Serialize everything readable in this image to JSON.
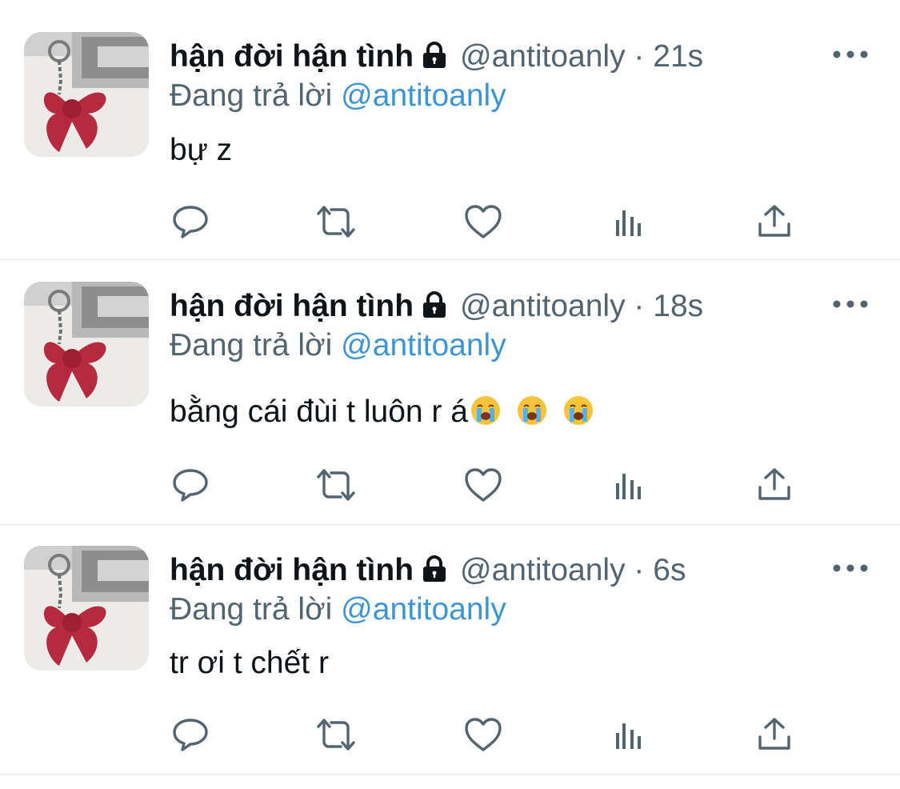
{
  "tweets": [
    {
      "name": "hận đời hận tình",
      "handle": "@antitoanly",
      "dot": "·",
      "time": "21s",
      "reply_prefix": "Đang trả lời",
      "reply_to": "@antitoanly",
      "text": "bự z",
      "emojis": []
    },
    {
      "name": "hận đời hận tình",
      "handle": "@antitoanly",
      "dot": "·",
      "time": "18s",
      "reply_prefix": "Đang trả lời",
      "reply_to": "@antitoanly",
      "text": "bằng cái đùi t luôn r á",
      "emojis": [
        "loudly-crying-face",
        "loudly-crying-face",
        "loudly-crying-face"
      ]
    },
    {
      "name": "hận đời hận tình",
      "handle": "@antitoanly",
      "dot": "·",
      "time": "6s",
      "reply_prefix": "Đang trả lời",
      "reply_to": "@antitoanly",
      "text": "tr ơi t chết r",
      "emojis": []
    }
  ],
  "icons": {
    "verified_lock": "lock-icon",
    "more": "more-horizontal-icon",
    "actions": [
      "reply-icon",
      "retweet-icon",
      "like-icon",
      "views-icon",
      "share-icon"
    ]
  },
  "colors": {
    "text": "#0f1419",
    "secondary": "#536471",
    "mention": "#3e95d6",
    "divider": "#eff1f3",
    "avatar_bow": "#b52a3e"
  }
}
